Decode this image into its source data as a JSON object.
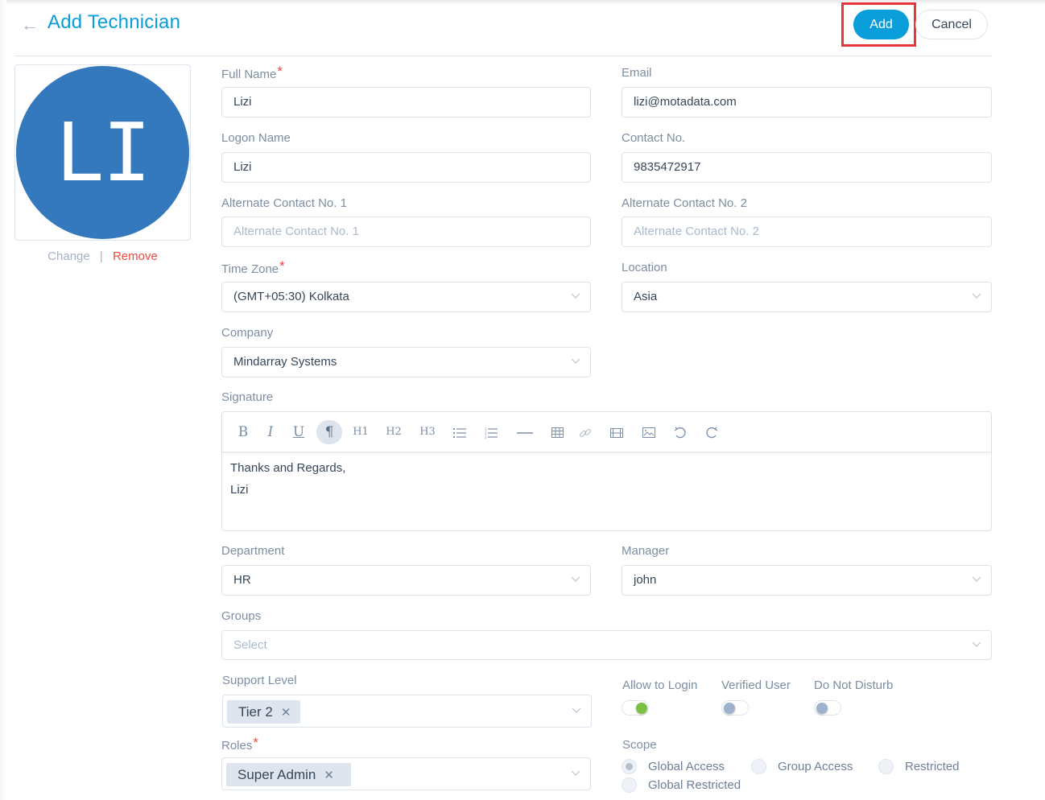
{
  "header": {
    "back_icon": "arrow-left-icon",
    "title": "Add Technician",
    "add_label": "Add",
    "cancel_label": "Cancel"
  },
  "avatar": {
    "initials": "LI",
    "color": "#3479bd",
    "change_label": "Change",
    "separator": "|",
    "remove_label": "Remove"
  },
  "form": {
    "full_name": {
      "label": "Full Name",
      "required": "*",
      "value": "Lizi"
    },
    "email": {
      "label": "Email",
      "value": "lizi@motadata.com"
    },
    "logon_name": {
      "label": "Logon Name",
      "value": "Lizi"
    },
    "contact_no": {
      "label": "Contact No.",
      "value": "9835472917"
    },
    "alt_contact_1": {
      "label": "Alternate Contact No. 1",
      "placeholder": "Alternate Contact No. 1"
    },
    "alt_contact_2": {
      "label": "Alternate Contact No. 2",
      "placeholder": "Alternate Contact No. 2"
    },
    "time_zone": {
      "label": "Time Zone",
      "required": "*",
      "value": "(GMT+05:30) Kolkata"
    },
    "location": {
      "label": "Location",
      "value": "Asia"
    },
    "company": {
      "label": "Company",
      "value": "Mindarray Systems"
    },
    "signature": {
      "label": "Signature",
      "toolbar": [
        {
          "name": "bold-icon",
          "glyph": "B"
        },
        {
          "name": "italic-icon",
          "glyph": "I"
        },
        {
          "name": "underline-icon",
          "glyph": "U"
        },
        {
          "name": "paragraph-icon",
          "glyph": "¶"
        },
        {
          "name": "heading-1-icon",
          "glyph": "H1"
        },
        {
          "name": "heading-2-icon",
          "glyph": "H2"
        },
        {
          "name": "heading-3-icon",
          "glyph": "H3"
        },
        {
          "name": "bullet-list-icon",
          "glyph": ""
        },
        {
          "name": "numbered-list-icon",
          "glyph": ""
        },
        {
          "name": "horizontal-rule-icon",
          "glyph": ""
        },
        {
          "name": "table-icon",
          "glyph": ""
        },
        {
          "name": "link-icon",
          "glyph": ""
        },
        {
          "name": "video-icon",
          "glyph": ""
        },
        {
          "name": "image-icon",
          "glyph": ""
        },
        {
          "name": "undo-icon",
          "glyph": ""
        },
        {
          "name": "redo-icon",
          "glyph": ""
        }
      ],
      "lines": [
        "Thanks and Regards,",
        "Lizi"
      ]
    },
    "department": {
      "label": "Department",
      "value": "HR"
    },
    "manager": {
      "label": "Manager",
      "value": "john"
    },
    "groups": {
      "label": "Groups",
      "placeholder": "Select"
    },
    "support_level": {
      "label": "Support Level",
      "tags": [
        "Tier 2"
      ]
    },
    "roles": {
      "label": "Roles",
      "required": "*",
      "tags": [
        "Super Admin"
      ]
    },
    "toggles": [
      {
        "label": "Allow to Login",
        "on": true
      },
      {
        "label": "Verified User",
        "on": false
      },
      {
        "label": "Do Not Disturb",
        "on": false
      }
    ],
    "scope": {
      "label": "Scope",
      "options": [
        {
          "label": "Global Access",
          "checked": true
        },
        {
          "label": "Group Access",
          "checked": false
        },
        {
          "label": "Restricted",
          "checked": false
        },
        {
          "label": "Global Restricted",
          "checked": false
        }
      ]
    }
  },
  "colors": {
    "accent": "#099dd9",
    "danger": "#ea4b42",
    "toggle_on": "#7cc242",
    "highlight_box": "#e8353b"
  }
}
